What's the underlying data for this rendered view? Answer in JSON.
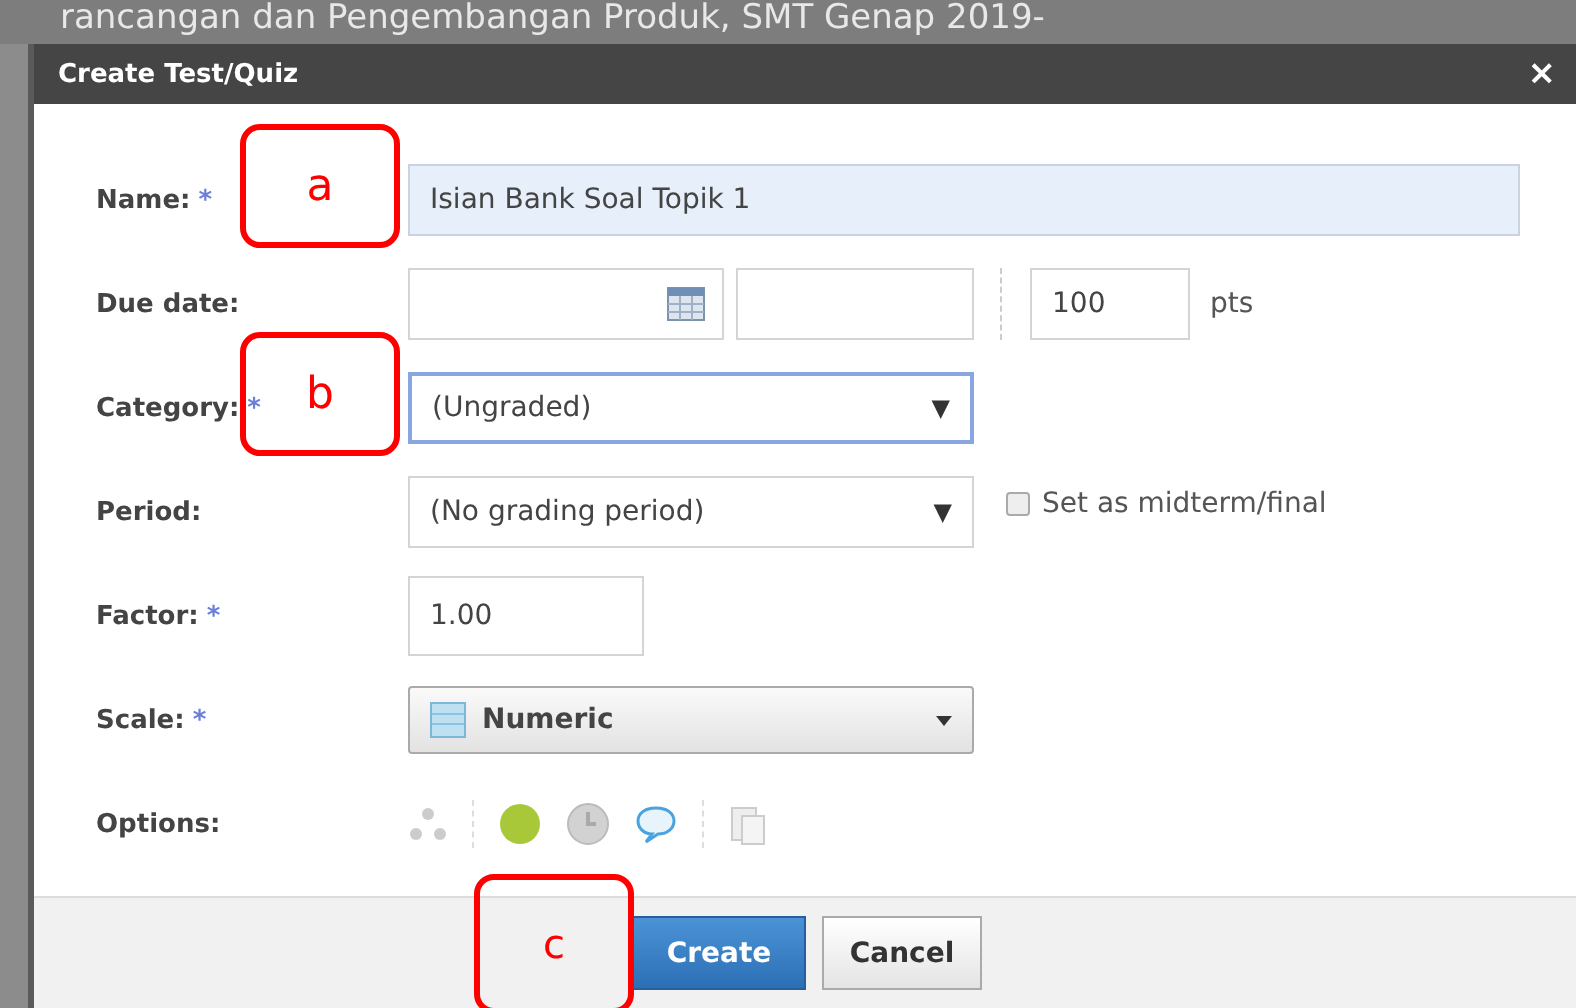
{
  "background_title": "rancangan dan Pengembangan Produk, SMT Genap 2019-",
  "dialog": {
    "title": "Create Test/Quiz",
    "close": "×"
  },
  "form": {
    "name": {
      "label": "Name:",
      "required_mark": "*",
      "value": "Isian Bank Soal Topik 1"
    },
    "due_date": {
      "label": "Due date:",
      "points": "100",
      "points_unit": "pts"
    },
    "category": {
      "label": "Category:",
      "required_mark": "*",
      "value": "(Ungraded)",
      "arrow": "▼"
    },
    "period": {
      "label": "Period:",
      "value": "(No grading period)",
      "arrow": "▼",
      "midterm": {
        "label": "Set as midterm/final",
        "checked": false
      }
    },
    "factor": {
      "label": "Factor:",
      "required_mark": "*",
      "value": "1.00"
    },
    "scale": {
      "label": "Scale:",
      "required_mark": "*",
      "value": "Numeric"
    },
    "options": {
      "label": "Options:"
    }
  },
  "buttons": [
    {
      "label": "Create",
      "kind": "primary"
    },
    {
      "label": "Cancel",
      "kind": "secondary"
    }
  ],
  "annotations": [
    {
      "label": "a"
    },
    {
      "label": "b"
    },
    {
      "label": "c"
    }
  ]
}
